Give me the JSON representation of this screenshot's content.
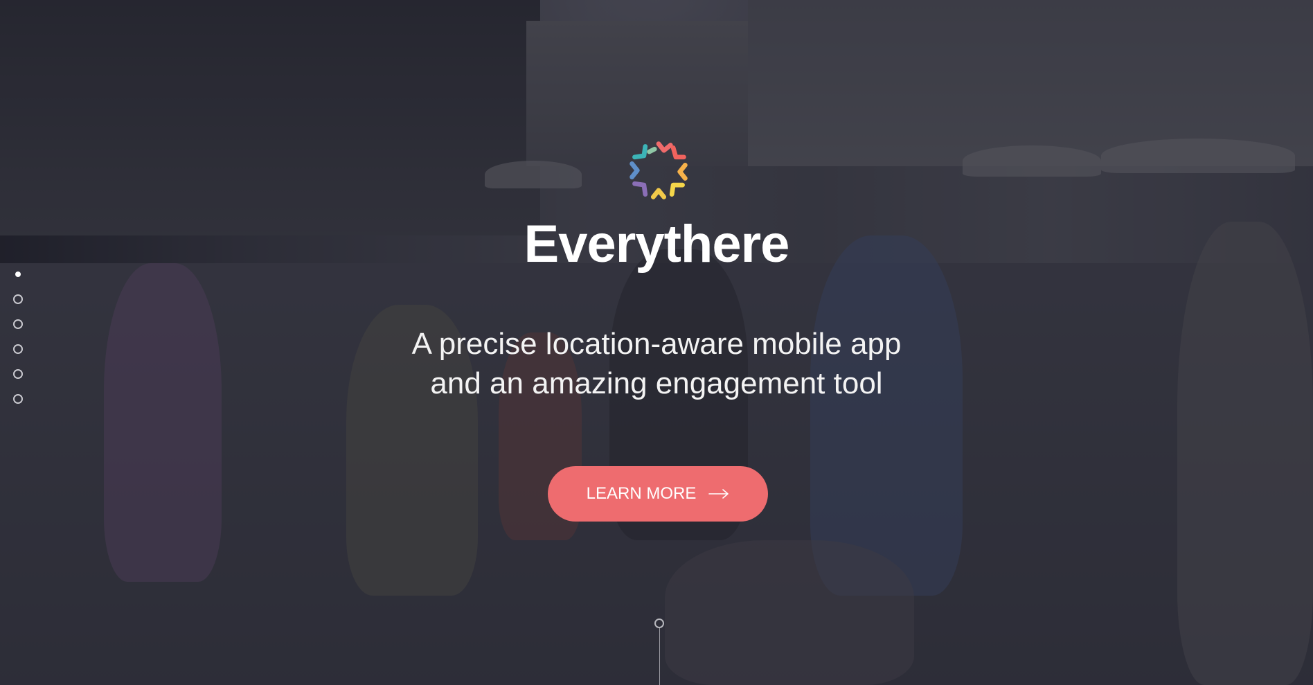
{
  "brand": {
    "name": "Everythere",
    "logo_icon": "everythere-logo-icon",
    "logo_colors": [
      "#f06b6b",
      "#f7b24a",
      "#f5d64a",
      "#8fc7a6",
      "#3cb4b7",
      "#5f8fc9",
      "#8b6fb7"
    ]
  },
  "hero": {
    "tagline_line1": "A precise location-aware mobile app",
    "tagline_line2": "and an amazing engagement tool",
    "cta_label": "LEARN MORE",
    "cta_icon": "arrow-right-icon",
    "cta_color": "#ee6c6f"
  },
  "side_nav": {
    "dots": [
      {
        "active": true
      },
      {
        "active": false
      },
      {
        "active": false
      },
      {
        "active": false
      },
      {
        "active": false
      },
      {
        "active": false
      }
    ]
  },
  "scroll_indicator": {
    "icon": "scroll-down-icon"
  }
}
